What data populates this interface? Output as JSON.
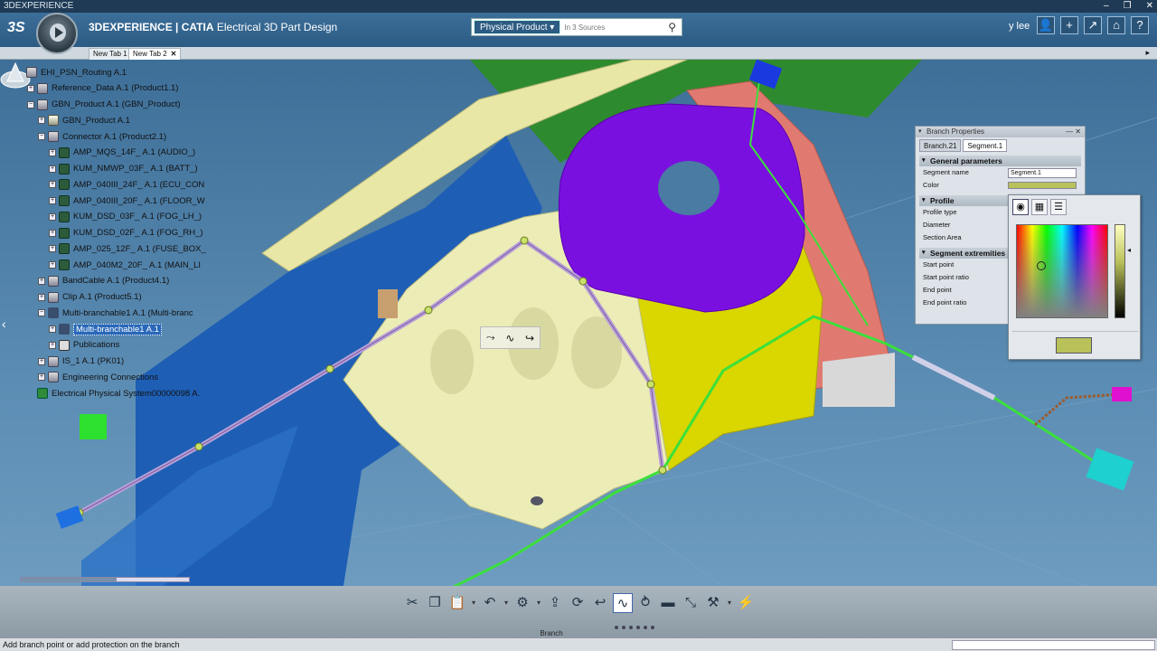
{
  "window": {
    "title": "3DEXPERIENCE",
    "controls": [
      "–",
      "❐",
      "✕"
    ]
  },
  "header": {
    "brand": "3DEXPERIENCE | ",
    "product": "CATIA",
    "app": " Electrical 3D Part Design",
    "search_scope": "Physical Product ▾",
    "search_placeholder": "In 3 Sources",
    "user": "y lee"
  },
  "tabs": [
    {
      "label": "New Tab 1",
      "active": false
    },
    {
      "label": "New Tab 2",
      "active": true
    }
  ],
  "tab_close": "✕",
  "tree": {
    "nodes": [
      {
        "label": "EHI_PSN_Routing A.1",
        "icon": "product-icon",
        "exp": "",
        "level": 0
      },
      {
        "label": "Reference_Data A.1 (Product1.1)",
        "icon": "product-icon",
        "exp": "+",
        "level": 1
      },
      {
        "label": "GBN_Product A.1 (GBN_Product)",
        "icon": "product-icon",
        "exp": "−",
        "level": 1
      },
      {
        "label": "GBN_Product A.1",
        "icon": "part-icon",
        "exp": "+",
        "level": 2
      },
      {
        "label": "Connector A.1 (Product2.1)",
        "icon": "product-icon",
        "exp": "−",
        "level": 2
      },
      {
        "label": "AMP_MQS_14F_ A.1 (AUDIO_)",
        "icon": "connector-icon",
        "exp": "+",
        "level": 3
      },
      {
        "label": "KUM_NMWP_03F_ A.1 (BATT_)",
        "icon": "connector-icon",
        "exp": "+",
        "level": 3
      },
      {
        "label": "AMP_040III_24F_ A.1 (ECU_CON",
        "icon": "connector-icon",
        "exp": "+",
        "level": 3
      },
      {
        "label": "AMP_040III_20F_ A.1 (FLOOR_W",
        "icon": "connector-icon",
        "exp": "+",
        "level": 3
      },
      {
        "label": "KUM_DSD_03F_ A.1 (FOG_LH_)",
        "icon": "connector-icon",
        "exp": "+",
        "level": 3
      },
      {
        "label": "KUM_DSD_02F_ A.1 (FOG_RH_)",
        "icon": "connector-icon",
        "exp": "+",
        "level": 3
      },
      {
        "label": "AMP_025_12F_ A.1 (FUSE_BOX_",
        "icon": "connector-icon",
        "exp": "+",
        "level": 3
      },
      {
        "label": "AMP_040M2_20F_ A.1 (MAIN_LI",
        "icon": "connector-icon",
        "exp": "+",
        "level": 3
      },
      {
        "label": "BandCable A.1 (Product4.1)",
        "icon": "product-icon",
        "exp": "+",
        "level": 2
      },
      {
        "label": "Clip A.1 (Product5.1)",
        "icon": "product-icon",
        "exp": "+",
        "level": 2
      },
      {
        "label": "Multi-branchable1 A.1 (Multi-branc",
        "icon": "cable-icon",
        "exp": "−",
        "level": 2
      },
      {
        "label": "Multi-branchable1 A.1",
        "icon": "cable-icon",
        "exp": "+",
        "level": 3,
        "selected": true
      },
      {
        "label": "Publications",
        "icon": "folder-icon",
        "exp": "+",
        "level": 3
      },
      {
        "label": "IS_1 A.1 (PK01)",
        "icon": "product-icon",
        "exp": "+",
        "level": 2
      },
      {
        "label": "Engineering Connections",
        "icon": "connection-icon",
        "exp": "+",
        "level": 2
      },
      {
        "label": "Electrical Physical System00000098 A.",
        "icon": "system-icon",
        "exp": "",
        "level": 1
      }
    ]
  },
  "panel": {
    "title": "Branch Properties",
    "tabs": [
      "Branch.21",
      "Segment.1"
    ],
    "general_header": "General parameters",
    "segment_name_label": "Segment name",
    "segment_name_value": "Segment.1",
    "color_label": "Color",
    "color_value": "#b9c15a",
    "profile_header": "Profile",
    "profile_type_label": "Profile type",
    "diameter_label": "Diameter",
    "section_area_label": "Section Area",
    "extremities_header": "Segment extremities",
    "start_point_label": "Start point",
    "start_point_ratio_label": "Start point ratio",
    "end_point_label": "End point",
    "end_point_ratio_label": "End point ratio"
  },
  "action_bar": {
    "section_label": "Branch"
  },
  "status": {
    "message": "Add branch point or add protection on the branch"
  },
  "colors": {
    "purple_part": "#7a10e0",
    "yellow_part": "#d9d600",
    "cream_part": "#ecedb6",
    "salmon_part": "#e07a70",
    "blue_part": "#1e5fb5",
    "green_part": "#2e8a2e",
    "wire_green": "#3be03b",
    "wire_purple": "#b8a0d8",
    "cyan_connector": "#1ed0d0",
    "magenta_connector": "#e010d0"
  }
}
